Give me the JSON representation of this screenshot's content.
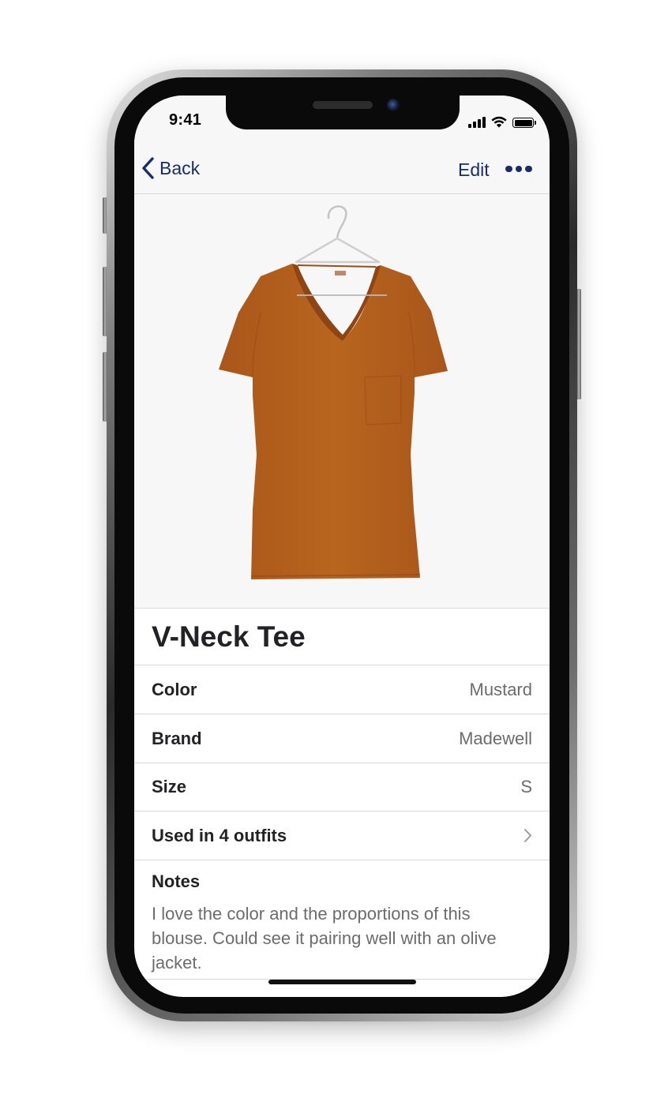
{
  "status_bar": {
    "time": "9:41",
    "icons": [
      "cellular-signal-icon",
      "wifi-icon",
      "battery-icon"
    ]
  },
  "nav": {
    "back_icon": "chevron-left-icon",
    "back_label": "Back",
    "edit_label": "Edit",
    "more_icon": "ellipsis-icon"
  },
  "item": {
    "image": "orange-v-neck-tshirt-on-hanger",
    "title": "V-Neck Tee",
    "details": [
      {
        "label": "Color",
        "value": "Mustard"
      },
      {
        "label": "Brand",
        "value": "Madewell"
      },
      {
        "label": "Size",
        "value": "S"
      }
    ],
    "outfits_label": "Used in 4 outfits",
    "outfits_icon": "chevron-right-icon",
    "notes_label": "Notes",
    "notes_text": "I love the color and the proportions of this blouse. Could see it pairing well with an olive jacket."
  },
  "colors": {
    "accent": "#1a2d6b",
    "shirt": "#b4601e",
    "text_primary": "#222226",
    "text_secondary": "#6b6b70"
  }
}
